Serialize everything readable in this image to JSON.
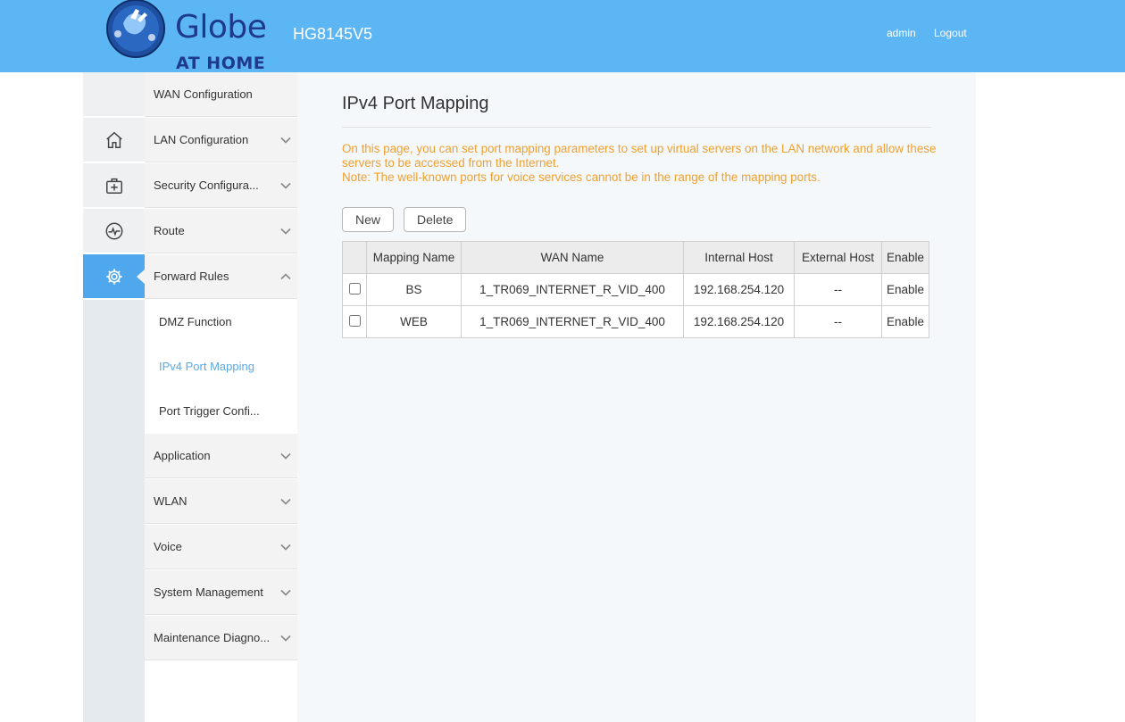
{
  "header": {
    "brand": "Globe",
    "brand_sub": "AT HOME",
    "model": "HG8145V5",
    "user": "admin",
    "logout": "Logout"
  },
  "rail": {
    "icons": [
      "home-icon",
      "medkit-icon",
      "pulse-icon",
      "gear-icon"
    ],
    "active_index": 3,
    "active_color": "#4fa8ee"
  },
  "menu": {
    "items": [
      {
        "label": "WAN Configuration"
      },
      {
        "label": "LAN Configuration"
      },
      {
        "label": "Security Configura..."
      },
      {
        "label": "Route"
      },
      {
        "label": "Forward Rules"
      },
      {
        "label": "Application"
      },
      {
        "label": "WLAN"
      },
      {
        "label": "Voice"
      },
      {
        "label": "System Management"
      },
      {
        "label": "Maintenance Diagno..."
      }
    ],
    "sub_items": [
      {
        "label": "DMZ Function"
      },
      {
        "label": "IPv4 Port Mapping"
      },
      {
        "label": "Port Trigger Confi..."
      }
    ],
    "active_sub_color": "#5aaae6"
  },
  "content": {
    "title": "IPv4 Port Mapping",
    "desc_line1": "On this page, you can set port mapping parameters to set up virtual servers on the LAN network and allow these servers to be accessed from the Internet.",
    "desc_line2": "Note: The well-known ports for voice services cannot be in the range of the mapping ports.",
    "desc_color": "#f0a030",
    "buttons": {
      "new": "New",
      "delete": "Delete"
    },
    "table": {
      "headers": [
        "Mapping Name",
        "WAN Name",
        "Internal Host",
        "External Host",
        "Enable"
      ],
      "rows": [
        [
          "BS",
          "1_TR069_INTERNET_R_VID_400",
          "192.168.254.120",
          "--",
          "Enable"
        ],
        [
          "WEB",
          "1_TR069_INTERNET_R_VID_400",
          "192.168.254.120",
          "--",
          "Enable"
        ]
      ]
    }
  }
}
